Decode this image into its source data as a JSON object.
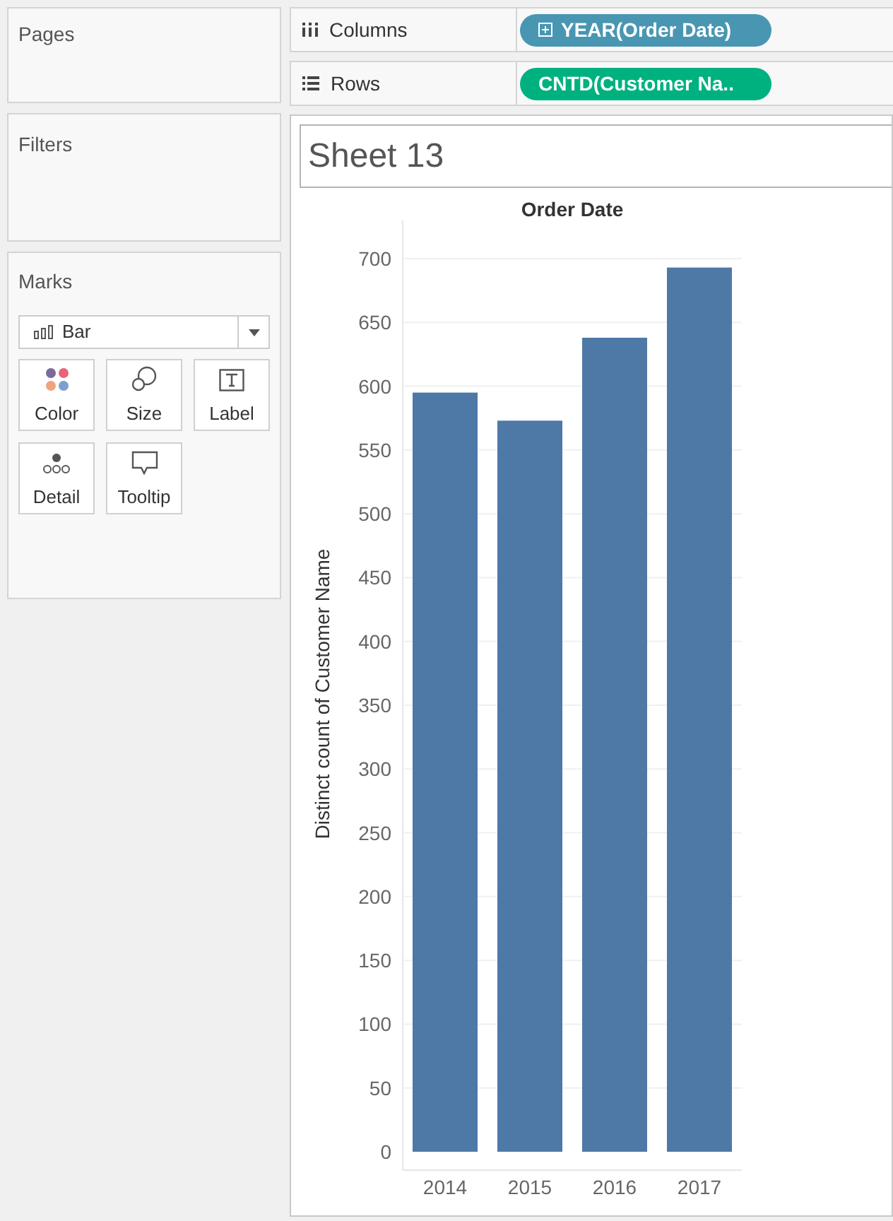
{
  "sidebar": {
    "pages": {
      "title": "Pages"
    },
    "filters": {
      "title": "Filters"
    },
    "marks": {
      "title": "Marks",
      "mark_type": "Bar",
      "cards": [
        {
          "label": "Color",
          "kind": "color"
        },
        {
          "label": "Size",
          "kind": "size"
        },
        {
          "label": "Label",
          "kind": "label"
        },
        {
          "label": "Detail",
          "kind": "detail"
        },
        {
          "label": "Tooltip",
          "kind": "tooltip"
        }
      ]
    }
  },
  "shelves": [
    {
      "label": "Columns",
      "kind": "columns",
      "pill": {
        "text": "YEAR(Order Date)",
        "color": "#4996b2",
        "expandable": true
      }
    },
    {
      "label": "Rows",
      "kind": "rows",
      "pill": {
        "text": "CNTD(Customer Na..",
        "color": "#00b180",
        "expandable": false
      }
    }
  ],
  "sheet": {
    "title": "Sheet 13",
    "chart_data": {
      "type": "bar",
      "xlabel": "Order Date",
      "ylabel": "Distinct count of Customer Name",
      "categories": [
        "2014",
        "2015",
        "2016",
        "2017"
      ],
      "series": [
        {
          "color": "#4e79a7",
          "values": [
            595,
            573,
            638,
            693
          ]
        }
      ],
      "grid": true,
      "ylim": [
        0,
        700
      ],
      "yticks": [
        0,
        50,
        100,
        150,
        200,
        250,
        300,
        350,
        400,
        450,
        500,
        550,
        600,
        650,
        700
      ]
    }
  }
}
